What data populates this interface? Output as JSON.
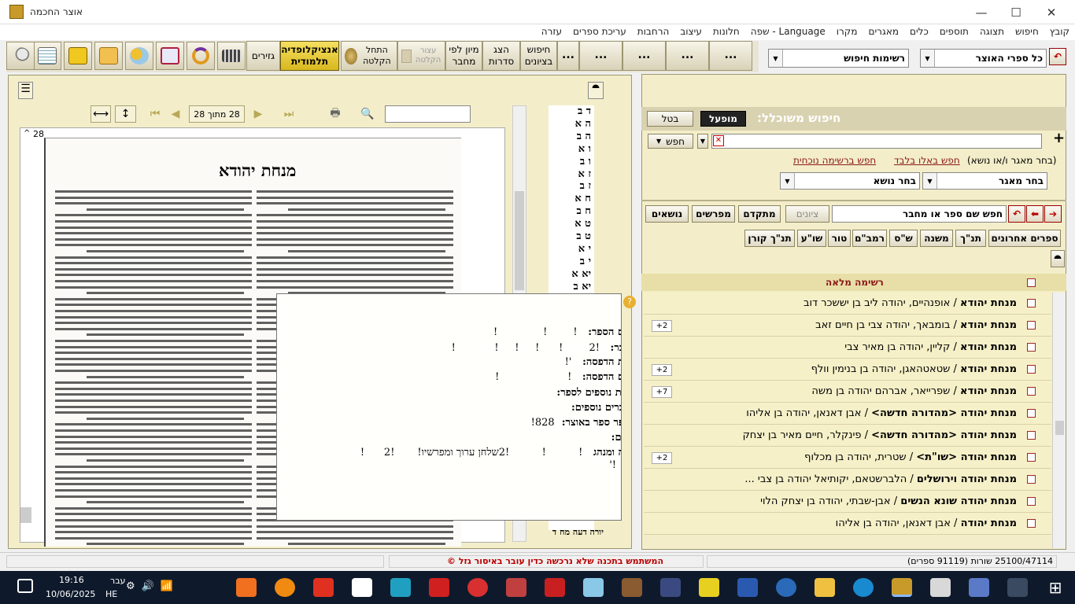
{
  "window": {
    "title": "אוצר החכמה",
    "min": "—",
    "max": "☐",
    "close": "✕"
  },
  "menu": [
    "קובץ",
    "חיפוש",
    "תצוגה",
    "תוספים",
    "כלים",
    "מאגרים",
    "מקרו",
    "Language - שפה",
    "חלונות",
    "עיצוב",
    "הרחבות",
    "עריכת ספרים",
    "עזרה"
  ],
  "toolbar": {
    "buttons": [
      "חיפוש בציונים",
      "הצג סדרות",
      "מיון לפי מחבר",
      "עצור הקלטה",
      "התחל הקלטה",
      "אנציקלופדיה תלמודית",
      "גזירים"
    ],
    "dots": "..."
  },
  "search_lists": {
    "all_books": "כל ספרי האוצר",
    "lists": "רשימות חיפוש"
  },
  "smart_search": {
    "title": "חיפוש משוכלל:",
    "active": "מופעל",
    "cancel": "בטל",
    "search_btn": "חפש",
    "clear": "✕",
    "plus": "+"
  },
  "hint": "(בחר מאגר ו/או נושא)",
  "links": {
    "in_these": "חפש באלו בלבד",
    "in_list": "חפש ברשימה נוכחית"
  },
  "choose_db": "בחר מאגר",
  "choose_topic": "בחר נושא",
  "name_search": {
    "placeholder": "חפש שם ספר או מחבר",
    "citations": "ציונים",
    "advanced": "מתקדם",
    "commentators": "מפרשים",
    "topics": "נושאים"
  },
  "categories": [
    "ספרים אחרונים",
    "תנ\"ך",
    "משנה",
    "ש\"ס",
    "רמב\"ם",
    "טור",
    "שו\"ע",
    "תנ\"ך קורן"
  ],
  "full_list": "רשימה מלאה",
  "results": [
    {
      "title": "מנחת יהודא",
      "author": "אופנהיים, יהודה ליב בן יששכר דוב",
      "badge": ""
    },
    {
      "title": "מנחת יהודא",
      "author": "בומבאך, יהודה צבי בן חיים זאב",
      "badge": "+2"
    },
    {
      "title": "מנחת יהודא",
      "author": "קליין, יהודה בן מאיר צבי",
      "badge": ""
    },
    {
      "title": "מנחת יהודא",
      "author": "שטאטהאגן, יהודה בן בנימין וולף",
      "badge": "+2"
    },
    {
      "title": "מנחת יהודא",
      "author": "שפרייאר, אברהם יהודה בן משה",
      "badge": "+7"
    },
    {
      "title": "מנחת יהודה <מהדורה חדשה>",
      "author": "אבן דאנאן, יהודה בן אליהו",
      "badge": ""
    },
    {
      "title": "מנחת יהודה <מהדורה חדשה>",
      "author": "פינקלר, חיים מאיר בן יצחק",
      "badge": ""
    },
    {
      "title": "מנחת יהודה <שו\"ת>",
      "author": "שטרית, יהודה בן מכלוף",
      "badge": "+2"
    },
    {
      "title": "מנחת יהודה וירושלים",
      "author": "הלברשטאם, יקותיאל יהודה בן צבי ...",
      "badge": ""
    },
    {
      "title": "מנחת יהודה שונא הנשים",
      "author": "אבן-שבתי, יהודה בן יצחק הלוי",
      "badge": ""
    },
    {
      "title": "מנחת יהודה",
      "author": "אבן דאנאן, יהודה בן אליהו",
      "badge": ""
    }
  ],
  "viewer": {
    "page_of": "28 מתוך 28",
    "page_num": "28",
    "scan_title": "מנחת יהודא"
  },
  "letters": [
    "ד ב",
    "ה א",
    "ה ב",
    "ו א",
    "ו ב",
    "ז א",
    "ז ב",
    "ח א",
    "ח ב",
    "ט א",
    "ט ב",
    "י א",
    "י ב",
    "יא א",
    "יא ב"
  ],
  "letters_bottom": [
    "יורה דעה מח ד"
  ],
  "popup": {
    "rows": [
      {
        "label": "ם הספר:",
        "value": "!        !              !"
      },
      {
        "label": "בר:",
        "value": "!2        !      !     !     !            !"
      },
      {
        "label": "ת הדפסה:",
        "value": "'!"
      },
      {
        "label": "ם הדפסה:",
        "value": "!                     !"
      },
      {
        "label": "ות נוספים לספר:",
        "value": ""
      },
      {
        "label": "ברים נוספים:",
        "value": ""
      },
      {
        "label": "פר ספר באוצר:",
        "value": "828!"
      },
      {
        "label": "ים:",
        "value": ""
      },
      {
        "label": "ה ומנהג",
        "value": "!          !          !2שלחן ערוך ומפרשיו!       !2      !"
      }
    ],
    "tail": "!'"
  },
  "status": {
    "warning": "המשתמש בתכנה שלא נרכשה כדין עובר באיסור גזל  ©",
    "count": "25100/47114 שורות (91119 ספרים)"
  },
  "taskbar": {
    "time": "19:16",
    "date": "10/06/2025",
    "lang1": "עבר",
    "lang2": "HE"
  }
}
